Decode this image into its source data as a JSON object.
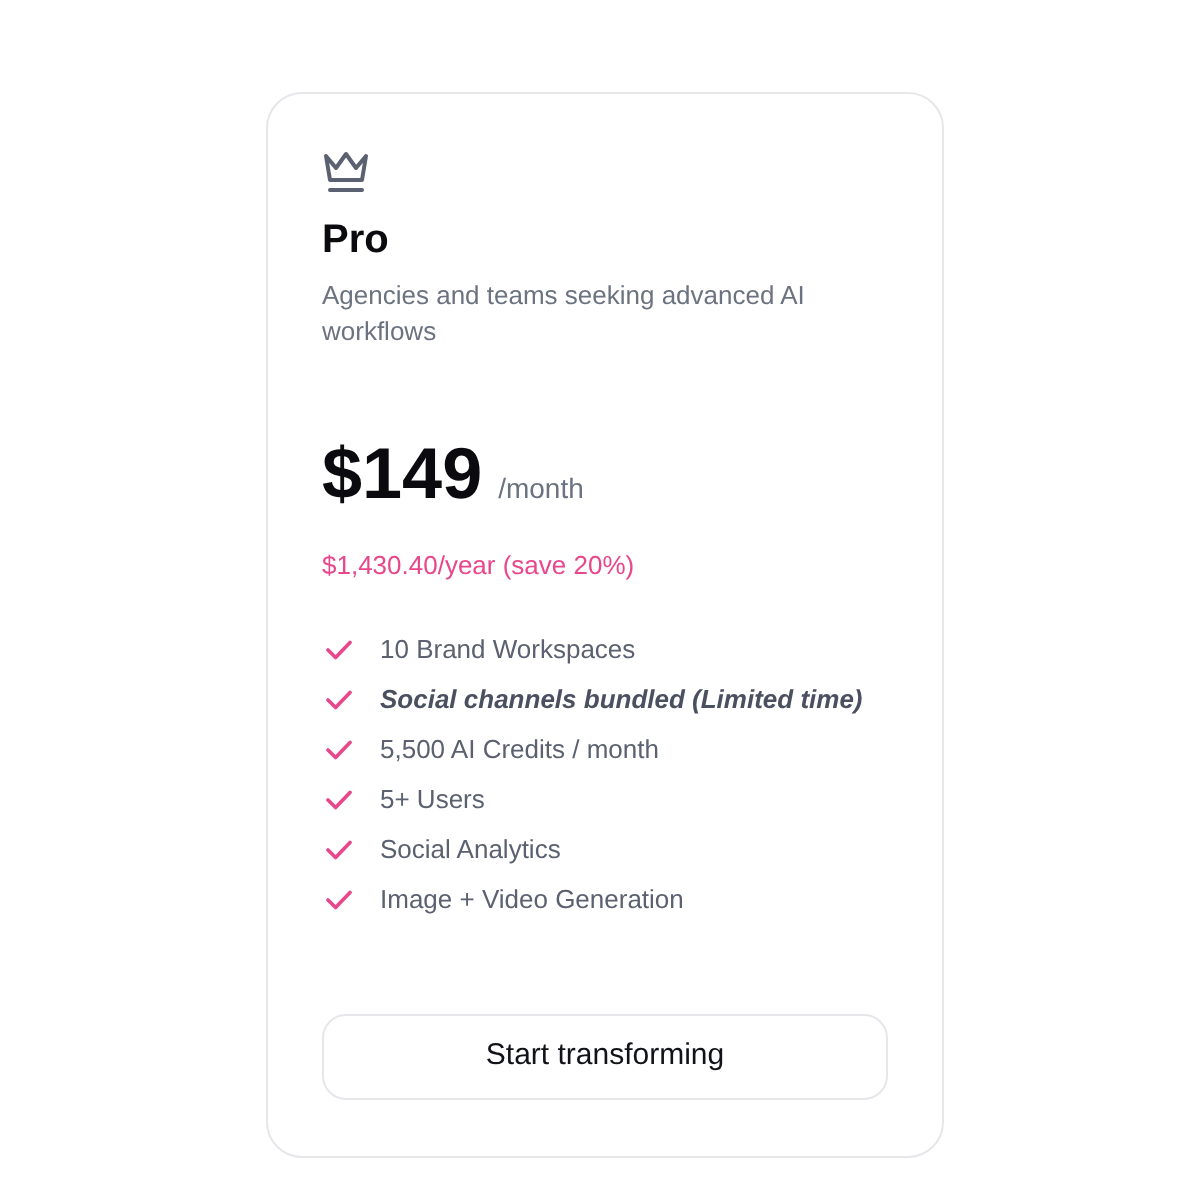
{
  "plan": {
    "name": "Pro",
    "description": "Agencies and teams seeking advanced AI workflows",
    "price": "$149",
    "period": "/month",
    "yearly_price": "$1,430.40/year (save 20%)",
    "features": [
      {
        "label": "10 Brand Workspaces",
        "highlighted": false
      },
      {
        "label": "Social channels bundled (Limited time)",
        "highlighted": true
      },
      {
        "label": "5,500 AI Credits / month",
        "highlighted": false
      },
      {
        "label": "5+ Users",
        "highlighted": false
      },
      {
        "label": "Social Analytics",
        "highlighted": false
      },
      {
        "label": "Image + Video Generation",
        "highlighted": false
      }
    ],
    "button": "Start transforming"
  }
}
